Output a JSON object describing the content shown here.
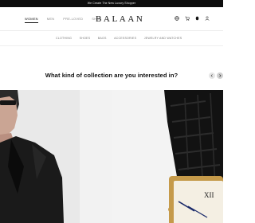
{
  "promo": {
    "text": "We Create The New Luxury Shopper"
  },
  "header": {
    "gender_tabs": [
      {
        "label": "WOMEN",
        "active": true
      },
      {
        "label": "MEN",
        "active": false
      },
      {
        "label": "PRE-LOVED",
        "active": false
      },
      {
        "label": "SHOP",
        "active": false
      }
    ],
    "logo": "BALAAN",
    "icons": [
      "globe-icon",
      "cart-icon",
      "notification-dot-icon",
      "user-icon"
    ]
  },
  "categories": [
    "CLOTHING",
    "SHOES",
    "BAGS",
    "ACCESSORIES",
    "JEWELRY AND WATCHES"
  ],
  "section": {
    "question": "What kind of collection are you interested in?"
  },
  "colors": {
    "promo_bg": "#0d0d0d",
    "text": "#111111",
    "muted": "#8a8a8a",
    "divider": "#ececec"
  }
}
